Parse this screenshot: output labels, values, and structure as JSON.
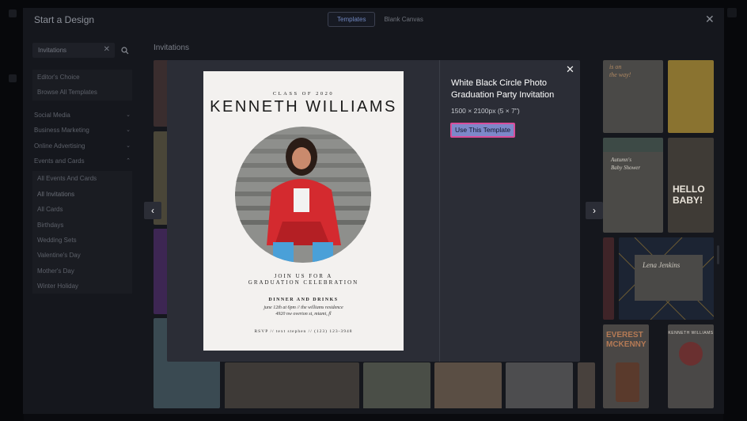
{
  "panel": {
    "title": "Start a Design",
    "tabs": [
      {
        "label": "Templates",
        "active": true
      },
      {
        "label": "Blank Canvas",
        "active": false
      }
    ],
    "close_icon": "close-icon"
  },
  "search": {
    "value": "Invitations",
    "clear_icon": "clear-icon",
    "search_icon": "search-icon"
  },
  "sidebar": {
    "group1": [
      "Editor's Choice",
      "Browse All Templates"
    ],
    "categories": [
      {
        "label": "Social Media",
        "chevron": "chevron-down-icon"
      },
      {
        "label": "Business Marketing",
        "chevron": "chevron-down-icon"
      },
      {
        "label": "Online Advertising",
        "chevron": "chevron-down-icon"
      },
      {
        "label": "Events and Cards",
        "chevron": "chevron-up-icon"
      }
    ],
    "events_sub": [
      "All Events And Cards",
      "All Invitations",
      "All Cards",
      "Birthdays",
      "Wedding Sets",
      "Valentine's Day",
      "Mother's Day",
      "Winter Holiday"
    ]
  },
  "main": {
    "heading": "Invitations"
  },
  "modal": {
    "title": "White Black Circle Photo Graduation Party Invitation",
    "size": "1500 × 2100px (5 × 7\")",
    "use_button": "Use This Template",
    "close_icon": "close-icon",
    "prev_icon": "chevron-left-icon",
    "next_icon": "chevron-right-icon",
    "preview": {
      "class_line": "CLASS OF 2020",
      "name": "KENNETH WILLIAMS",
      "join_line1": "JOIN US FOR A",
      "join_line2": "GRADUATION CELEBRATION",
      "dinner": "DINNER AND DRINKS",
      "info_line1": "june 12th at 6pm // the williams residence",
      "info_line2": "4920 nw overton st, miami, fl",
      "rsvp": "RSVP // text stephen // (123) 123-3948"
    }
  },
  "thumbnails": {
    "t1_line1": "is on",
    "t1_line2": "the way!",
    "t2_line1": "Autumn's",
    "t2_line2": "Baby Shower",
    "t3_line1": "HELLO",
    "t3_line2": "BABY!",
    "t4_name": "Lena Jenkins",
    "t5_line1": "EVEREST",
    "t5_line2": "MCKENNY",
    "t6_name": "KENNETH WILLIAMS"
  },
  "colors": {
    "accent_button": "#7d88c9",
    "focus_ring": "#d94d9a",
    "tab_active": "#6f86bf"
  }
}
